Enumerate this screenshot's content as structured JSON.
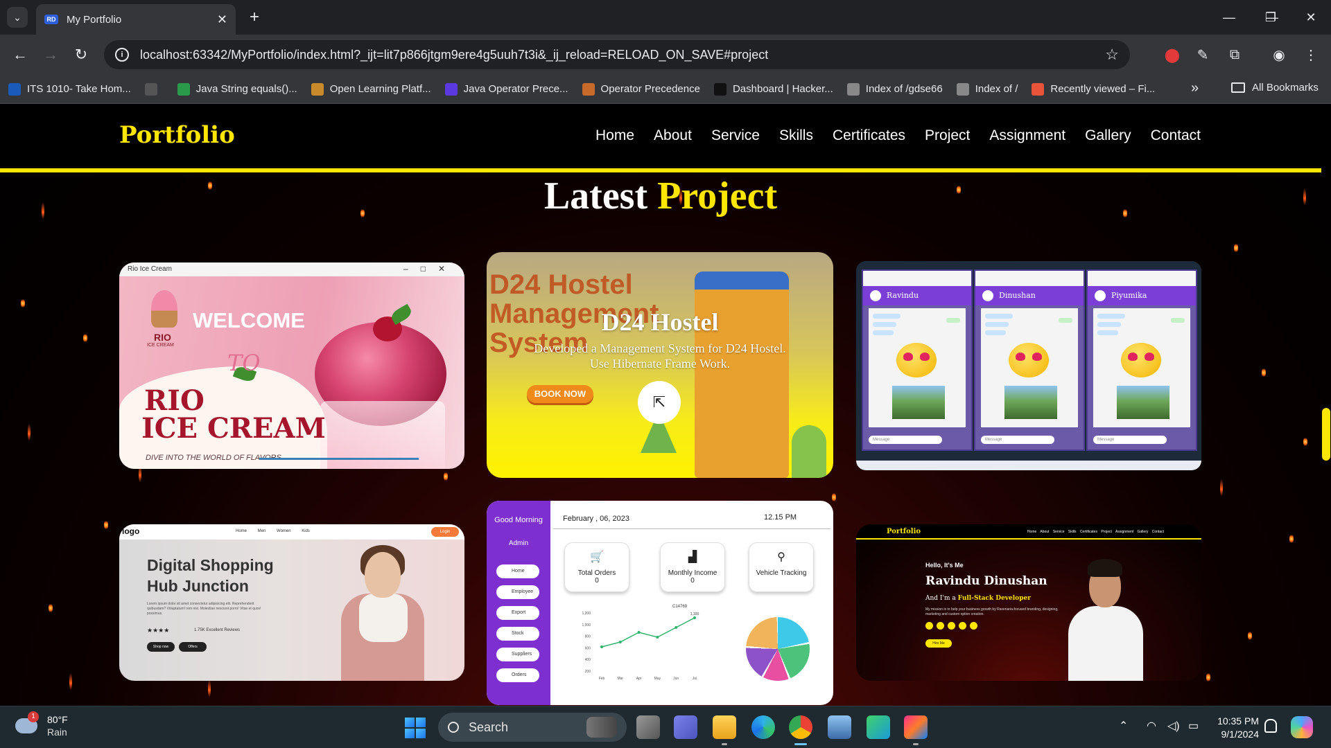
{
  "browser": {
    "tab_title": "My Portfolio",
    "tab_favicon_text": "RD",
    "url": "localhost:63342/MyPortfolio/index.html?_ijt=lit7p866jtgm9ere4g5uuh7t3i&_ij_reload=RELOAD_ON_SAVE#project",
    "bookmarks": [
      {
        "label": "ITS 1010- Take Hom...",
        "icon_color": "#1a5ab8"
      },
      {
        "label": "",
        "icon_color": "#555"
      },
      {
        "label": "Java String equals()...",
        "icon_color": "#2a9a4a"
      },
      {
        "label": "Open Learning Platf...",
        "icon_color": "#c88a2a"
      },
      {
        "label": "Java Operator Prece...",
        "icon_color": "#5a3ae0"
      },
      {
        "label": "Operator Precedence",
        "icon_color": "#c86a2a"
      },
      {
        "label": "Dashboard | Hacker...",
        "icon_color": "#111"
      },
      {
        "label": "Index of /gdse66",
        "icon_color": "#888"
      },
      {
        "label": "Index of /",
        "icon_color": "#888"
      },
      {
        "label": "Recently viewed – Fi...",
        "icon_color": "#e8543a"
      }
    ],
    "all_bookmarks_label": "All Bookmarks"
  },
  "site": {
    "logo": "Portfolio",
    "nav": [
      "Home",
      "About",
      "Service",
      "Skills",
      "Certificates",
      "Project",
      "Assignment",
      "Gallery",
      "Contact"
    ],
    "section_title_white": "Latest",
    "section_title_accent": "Project"
  },
  "projects": {
    "rio": {
      "window_title": "Rio Ice Cream",
      "logo_text": "RIO",
      "logo_sub": "ICE CREAM",
      "welcome": "WELCOME",
      "to": "TO",
      "brand_line1": "RIO",
      "brand_line2": "ICE CREAM",
      "tagline": "DIVE INTO THE WORLD OF FLAVORS"
    },
    "hostel": {
      "bg_title": "D24 Hostel Management System",
      "title": "D24 Hostel",
      "desc_line1": "Developed a Management System for D24 Hostel.",
      "desc_line2": "Use Hibernate Frame Work.",
      "book_label": "BOOK NOW",
      "link_icon": "external-link-icon"
    },
    "chat": {
      "users": [
        "Ravindu",
        "Dinushan",
        "Piyumika"
      ],
      "input_placeholder": "Message"
    },
    "shop": {
      "logo": "logo",
      "menu": "Home Men Women Kids",
      "login": "Login",
      "heading_line1": "Digital Shopping",
      "heading_line2": "Hub Junction",
      "lorem": "Lorem ipsum dolor sit amet consectetur adipisicing elit. Reprehenderit quibusdam? Voluptatum! rem nisi. Molestiae nesciunt porro! Vitae et quos! possimus.",
      "stars": "★★★★",
      "reviews": "1.75K Excellent Reviews",
      "btn1": "Shop now",
      "btn2": "Offers"
    },
    "dashboard": {
      "greeting": "Good Morning",
      "role": "Admin",
      "nav": [
        "Home",
        "Employee",
        "Export",
        "Stock",
        "Suppliers",
        "Orders"
      ],
      "date": "February , 06, 2023",
      "time": "12.15 PM",
      "stats": [
        {
          "label": "Total Orders",
          "value": "0",
          "icon": "cart-icon"
        },
        {
          "label": "Monthly Income",
          "value": "0",
          "icon": "bar-chart-icon"
        },
        {
          "label": "Vehicle Tracking",
          "value": "",
          "icon": "location-pin-icon"
        }
      ],
      "chart_label": "C14769",
      "chart_peak_label": "1,100",
      "y_ticks": [
        "1,200",
        "1,000",
        "800",
        "600",
        "400",
        "200"
      ],
      "x_ticks": [
        "Feb",
        "Mar",
        "Apr",
        "May",
        "Jun",
        "Jul"
      ],
      "line_values": [
        500,
        600,
        800,
        700,
        900,
        1100
      ],
      "pie_colors": [
        "#3ec9e8",
        "#4cc27a",
        "#e84fa0",
        "#8e52c8",
        "#f2b45a"
      ]
    },
    "portfolio": {
      "logo": "Portfolio",
      "menu": "Home About Service Skills Certificates Project Assignment Gallery Contact",
      "hello": "Hello, It's Me",
      "name": "Ravindu Dinushan",
      "role_prefix": "And I'm a",
      "role": "Full-Stack Developer",
      "desc": "My mission is to help your business growth by Ravenaria-focused branding, designing, marketing and custom option creation.",
      "hire": "Hire Me"
    }
  },
  "taskbar": {
    "temp": "80°F",
    "condition": "Rain",
    "notification_count": "1",
    "search_placeholder": "Search",
    "time": "10:35 PM",
    "date": "9/1/2024"
  },
  "theme": {
    "accent": "#ffe600",
    "background": "#000000"
  }
}
